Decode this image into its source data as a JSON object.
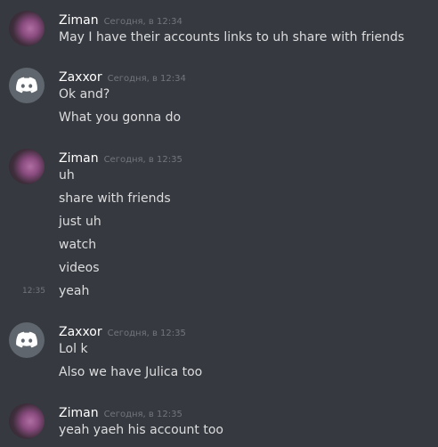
{
  "messages": [
    {
      "author": "Ziman",
      "timestamp": "Сегодня, в 12:34",
      "avatar": "photo-avatar",
      "lines": [
        "May I have their accounts links to uh share with friends"
      ]
    },
    {
      "author": "Zaxxor",
      "timestamp": "Сегодня, в 12:34",
      "avatar": "discord-logo-icon",
      "lines": [
        "Ok and?",
        "What you gonna do"
      ]
    },
    {
      "author": "Ziman",
      "timestamp": "Сегодня, в 12:35",
      "avatar": "photo-avatar",
      "lines": [
        "uh",
        "share with friends",
        "just uh",
        "watch",
        "videos",
        "yeah"
      ],
      "hover_time": "12:35"
    },
    {
      "author": "Zaxxor",
      "timestamp": "Сегодня, в 12:35",
      "avatar": "discord-logo-icon",
      "lines": [
        "Lol k",
        "Also we have Julica too"
      ]
    },
    {
      "author": "Ziman",
      "timestamp": "Сегодня, в 12:35",
      "avatar": "photo-avatar",
      "lines": [
        "yeah yaeh his account too"
      ]
    }
  ],
  "colors": {
    "background": "#36393f",
    "username": "#ffffff",
    "message_text": "#dcddde",
    "timestamp": "#72767d",
    "discord_avatar_bg": "#5f666d"
  }
}
